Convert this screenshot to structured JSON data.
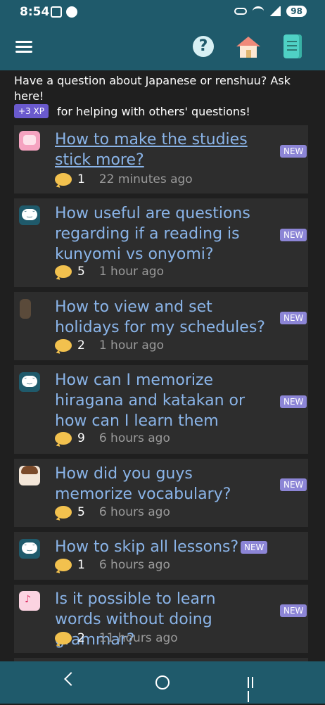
{
  "status": {
    "time": "8:54",
    "battery": "98"
  },
  "header": {
    "help": "?"
  },
  "intro": {
    "text": "Have a question about Japanese or renshuu? Ask here!",
    "xp_badge": "+3 XP",
    "xp_text": "for helping with others' questions!"
  },
  "threads": [
    {
      "title": "How to make the studies stick more?",
      "badge": "NEW",
      "count": "1",
      "time": "22 minutes ago"
    },
    {
      "title": "How useful are questions regarding if a reading is kunyomi vs onyomi?",
      "badge": "NEW",
      "count": "5",
      "time": "1 hour ago"
    },
    {
      "title": "How to view and set holidays for my schedules?",
      "badge": "NEW",
      "count": "2",
      "time": "1 hour ago"
    },
    {
      "title": "How can I memorize hiragana and katakan or how can I learn them",
      "badge": "NEW",
      "count": "9",
      "time": "6 hours ago"
    },
    {
      "title": "How did you guys memorize vocabulary?",
      "badge": "NEW",
      "count": "5",
      "time": "6 hours ago"
    },
    {
      "title": "How to skip all lessons?",
      "badge": "NEW",
      "count": "1",
      "time": "6 hours ago"
    },
    {
      "title": "Is it possible to learn words without doing grammar?",
      "badge": "NEW",
      "count": "2",
      "time": "11 hours ago"
    }
  ]
}
